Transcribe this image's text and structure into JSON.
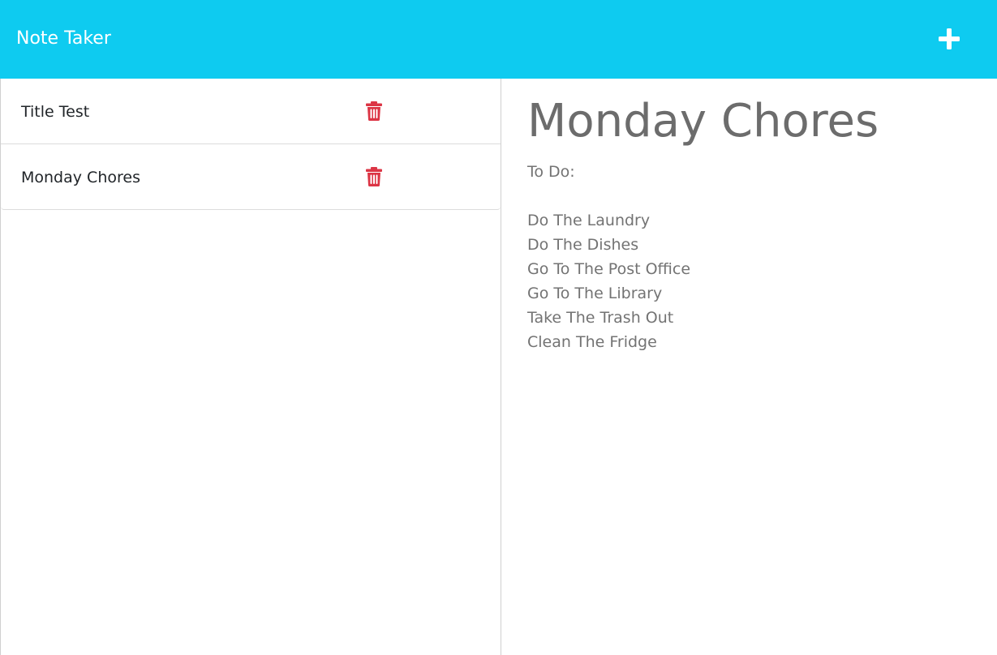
{
  "app": {
    "title": "Note Taker"
  },
  "toolbar": {
    "new_note_icon": "plus-icon"
  },
  "notes": [
    {
      "title": "Title Test",
      "delete_icon": "trash-icon"
    },
    {
      "title": "Monday Chores",
      "delete_icon": "trash-icon"
    }
  ],
  "active_note": {
    "title": "Monday Chores",
    "text": "To Do:\n\nDo The Laundry\nDo The Dishes\nGo To The Post Office\nGo To The Library\nTake The Trash Out\nClean The Fridge"
  },
  "colors": {
    "navbar": "#0ecbf0",
    "delete_icon": "#dc3545",
    "heading_text": "#6c6c6c",
    "body_text": "#737373"
  }
}
